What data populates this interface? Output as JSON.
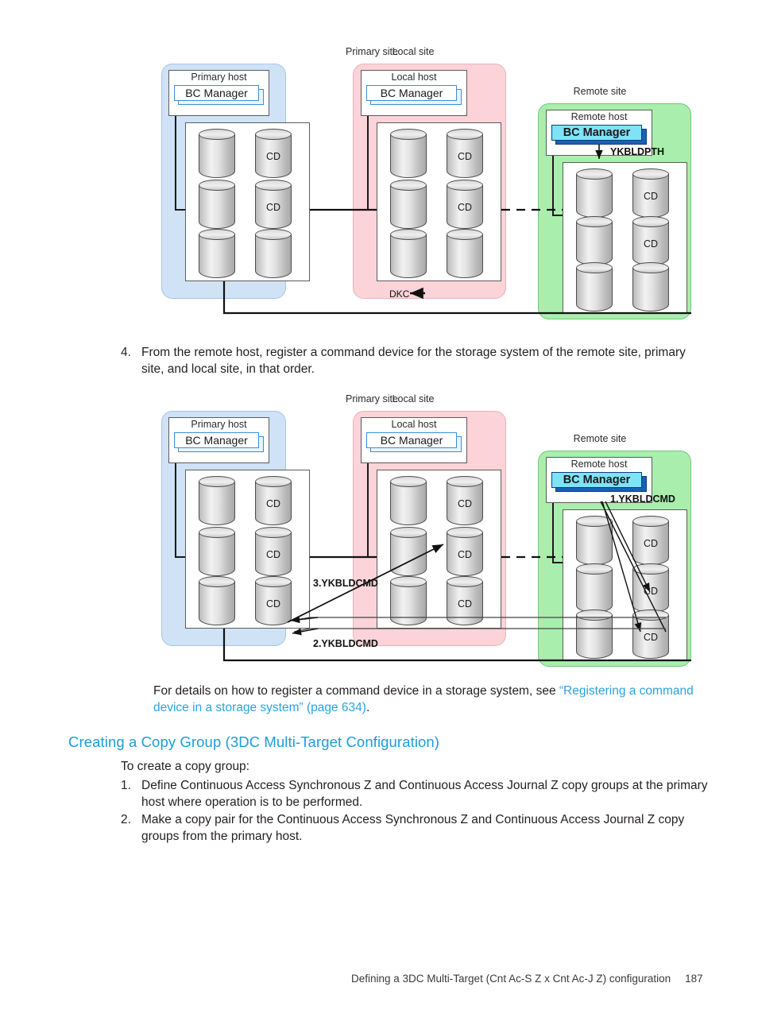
{
  "page": {
    "number": "187",
    "footer_title": "Defining a 3DC Multi-Target (Cnt Ac-S Z x Cnt Ac-J Z) configuration"
  },
  "step4": {
    "number": "4.",
    "text": "From the remote host, register a command device for the storage system of the remote site, primary site, and local site, in that order."
  },
  "details_note": {
    "lead": "For details on how to register a command device in a storage system, see ",
    "link": "“Registering a command device in a storage system” (page 634)",
    "tail": "."
  },
  "section": {
    "heading": "Creating a Copy Group (3DC Multi-Target Configuration)",
    "intro": "To create a copy group:",
    "steps": [
      {
        "number": "1.",
        "text": "Define Continuous Access Synchronous Z and Continuous Access Journal Z copy groups at the primary host where operation is to be performed."
      },
      {
        "number": "2.",
        "text": "Make a copy pair for the Continuous Access Synchronous Z and Continuous Access Journal Z copy groups from the primary host."
      }
    ]
  },
  "diagram1": {
    "sites": [
      {
        "key": "primary",
        "site_label": "Primary site",
        "host_title": "Primary host",
        "bcm_label": "BC Manager",
        "disks": [
          {
            "cd": ""
          },
          {
            "cd": "CD"
          },
          {
            "cd": ""
          },
          {
            "cd": "CD"
          },
          {
            "cd": ""
          },
          {
            "cd": ""
          }
        ]
      },
      {
        "key": "local",
        "site_label": "Local site",
        "host_title": "Local host",
        "bcm_label": "BC Manager",
        "disks": [
          {
            "cd": ""
          },
          {
            "cd": "CD"
          },
          {
            "cd": ""
          },
          {
            "cd": "CD"
          },
          {
            "cd": ""
          },
          {
            "cd": ""
          }
        ]
      },
      {
        "key": "remote",
        "site_label": "Remote site",
        "host_title": "Remote host",
        "bcm_label": "BC Manager",
        "disks": [
          {
            "cd": ""
          },
          {
            "cd": "CD"
          },
          {
            "cd": ""
          },
          {
            "cd": "CD"
          },
          {
            "cd": ""
          },
          {
            "cd": ""
          }
        ]
      }
    ],
    "labels": {
      "ykbldpth": "YKBLDPTH",
      "dkc": "DKC"
    }
  },
  "diagram2": {
    "sites": [
      {
        "key": "primary",
        "site_label": "Primary site",
        "host_title": "Primary host",
        "bcm_label": "BC Manager",
        "disks": [
          {
            "cd": ""
          },
          {
            "cd": "CD"
          },
          {
            "cd": ""
          },
          {
            "cd": "CD"
          },
          {
            "cd": ""
          },
          {
            "cd": "CD"
          }
        ]
      },
      {
        "key": "local",
        "site_label": "Local site",
        "host_title": "Local host",
        "bcm_label": "BC Manager",
        "disks": [
          {
            "cd": ""
          },
          {
            "cd": "CD"
          },
          {
            "cd": ""
          },
          {
            "cd": "CD"
          },
          {
            "cd": ""
          },
          {
            "cd": "CD"
          }
        ]
      },
      {
        "key": "remote",
        "site_label": "Remote site",
        "host_title": "Remote host",
        "bcm_label": "BC Manager",
        "disks": [
          {
            "cd": ""
          },
          {
            "cd": "CD"
          },
          {
            "cd": ""
          },
          {
            "cd": "CD"
          },
          {
            "cd": ""
          },
          {
            "cd": "CD"
          }
        ]
      }
    ],
    "labels": {
      "step1": "1.YKBLDCMD",
      "step2": "2.YKBLDCMD",
      "step3": "3.YKBLDCMD"
    }
  },
  "colors": {
    "accent_blue": "#1b9ddb",
    "link_blue": "#2aa3e0",
    "primary_site_fill": "#cfe2f6",
    "local_site_fill": "#fbd3d8",
    "remote_site_fill": "#a9eeac",
    "bcm_highlight_fill": "#7fe3f8",
    "bcm_highlight_side": "#1a5fb4"
  }
}
